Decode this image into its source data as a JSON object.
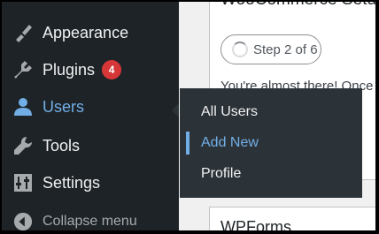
{
  "sidebar": {
    "items": [
      {
        "label": "Appearance",
        "icon": "paintbrush-icon"
      },
      {
        "label": "Plugins",
        "icon": "plugin-icon",
        "badge": "4"
      },
      {
        "label": "Users",
        "icon": "user-icon",
        "active": true
      },
      {
        "label": "Tools",
        "icon": "wrench-icon"
      },
      {
        "label": "Settings",
        "icon": "settings-sliders-icon"
      }
    ],
    "collapse_label": "Collapse menu"
  },
  "flyout": {
    "items": [
      {
        "label": "All Users"
      },
      {
        "label": "Add New",
        "current": true
      },
      {
        "label": "Profile"
      }
    ]
  },
  "content": {
    "card_title": "WooCommerce Setup",
    "step_label": "Step 2 of 6",
    "card_text": "You're almost there! Once you complete",
    "second_card_title": "WPForms"
  },
  "colors": {
    "sidebar_bg": "#1d2327",
    "flyout_bg": "#2c3338",
    "accent": "#72aee6",
    "badge": "#d63638"
  }
}
